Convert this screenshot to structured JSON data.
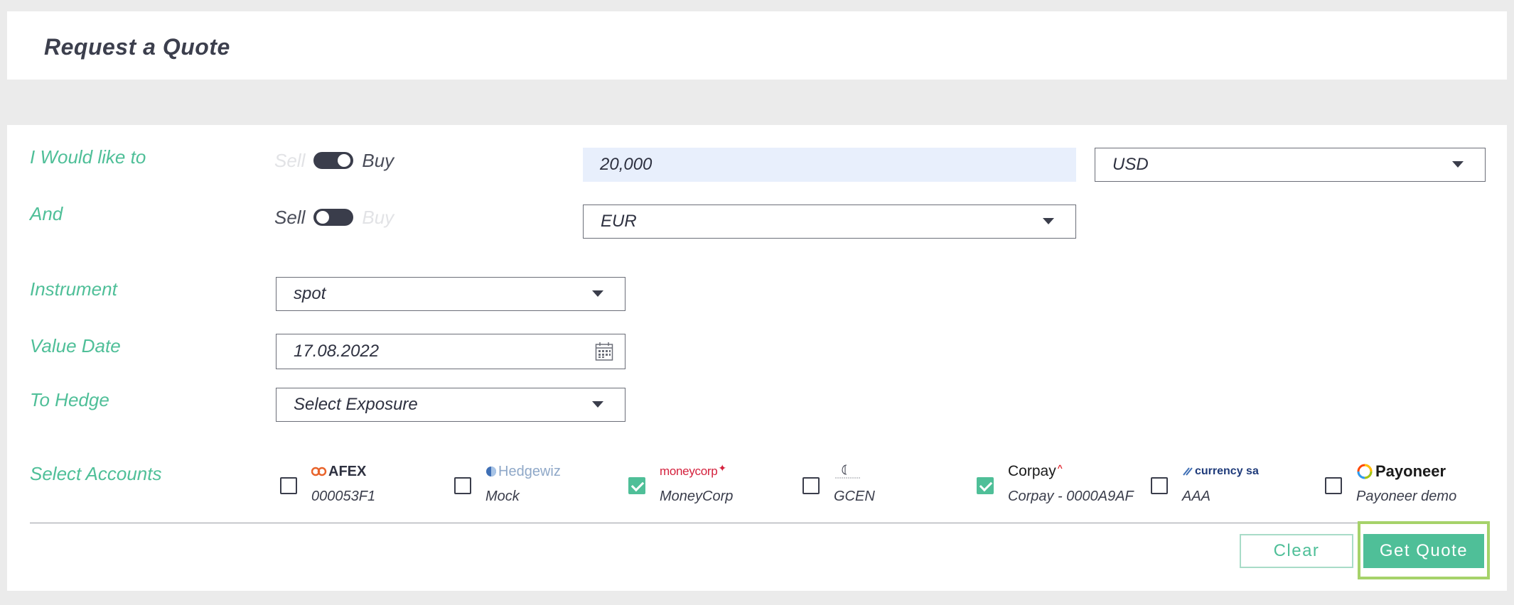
{
  "header": {
    "title": "Request a Quote"
  },
  "form": {
    "row1": {
      "label": "I Would like to",
      "toggle": {
        "left": "Sell",
        "right": "Buy",
        "state": "Buy"
      },
      "amount": "20,000",
      "currency": "USD"
    },
    "row2": {
      "label": "And",
      "toggle": {
        "left": "Sell",
        "right": "Buy",
        "state": "Sell"
      },
      "currency": "EUR"
    },
    "instrument": {
      "label": "Instrument",
      "value": "spot"
    },
    "value_date": {
      "label": "Value Date",
      "value": "17.08.2022"
    },
    "to_hedge": {
      "label": "To Hedge",
      "value": "Select Exposure"
    },
    "accounts": {
      "label": "Select Accounts",
      "items": [
        {
          "logo": "AFEX",
          "name": "000053F1",
          "checked": false
        },
        {
          "logo": "Hedgewiz",
          "name": "Mock",
          "checked": false
        },
        {
          "logo": "moneycorp",
          "name": "MoneyCorp",
          "checked": true
        },
        {
          "logo": "",
          "name": "GCEN",
          "checked": false
        },
        {
          "logo": "Corpay",
          "name": "Corpay - 0000A9AF",
          "checked": true
        },
        {
          "logo": "currency sa",
          "name": "AAA",
          "checked": false
        },
        {
          "logo": "Payoneer",
          "name": "Payoneer demo",
          "checked": false
        }
      ]
    }
  },
  "actions": {
    "clear": "Clear",
    "get_quote": "Get Quote"
  },
  "colors": {
    "accent": "#4fbf98",
    "highlight": "#a6d26a",
    "toggle": "#3a3d4b",
    "amount_bg": "#e8effc"
  }
}
